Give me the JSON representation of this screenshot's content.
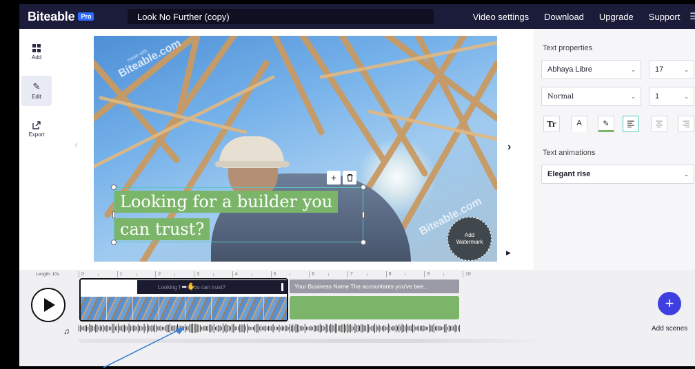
{
  "topbar": {
    "logo": "Biteable",
    "badge": "Pro",
    "project_title": "Look No Further (copy)",
    "nav": [
      "Video settings",
      "Download",
      "Upgrade",
      "Support"
    ],
    "menu_icon": "hamburger-icon"
  },
  "sidebar": {
    "items": [
      {
        "label": "Add",
        "icon": "grid-icon"
      },
      {
        "label": "Edit",
        "icon": "pencil-icon"
      },
      {
        "label": "Export",
        "icon": "export-icon"
      }
    ],
    "active": "Edit"
  },
  "canvas": {
    "watermark_small": "made with",
    "watermark_brand": "Biteable.com",
    "watermark_corner": "Biteable.com",
    "text_line_1": "Looking for a builder you",
    "text_line_2": "can trust?",
    "add_watermark": [
      "Add",
      "Watermark"
    ]
  },
  "panel": {
    "text_properties_title": "Text properties",
    "font_family": "Abhaya Libre",
    "font_size": "17",
    "font_style": "Normal",
    "line_spacing": "1",
    "format_buttons": [
      "Tr",
      "A",
      "highlight",
      "align-left",
      "align-center",
      "align-right"
    ],
    "active_format": "align-left",
    "text_animations_title": "Text animations",
    "animation": "Elegant rise"
  },
  "timeline": {
    "length_label": "Length: 10s",
    "ticks": [
      "0",
      "1",
      "2",
      "3",
      "4",
      "5",
      "6",
      "7",
      "8",
      "9",
      "10"
    ],
    "scene1_text_before": "Looking f",
    "scene1_text_after": "r you can trust?",
    "scene2_text": "Your Business Name The accountants you've bee...",
    "add_scenes_label": "Add scenes"
  },
  "colors": {
    "topbar": "#1b1b3a",
    "accent_green": "#7bb56a",
    "accent_blue": "#3f3fe0",
    "selection_teal": "#4ec7b6"
  }
}
